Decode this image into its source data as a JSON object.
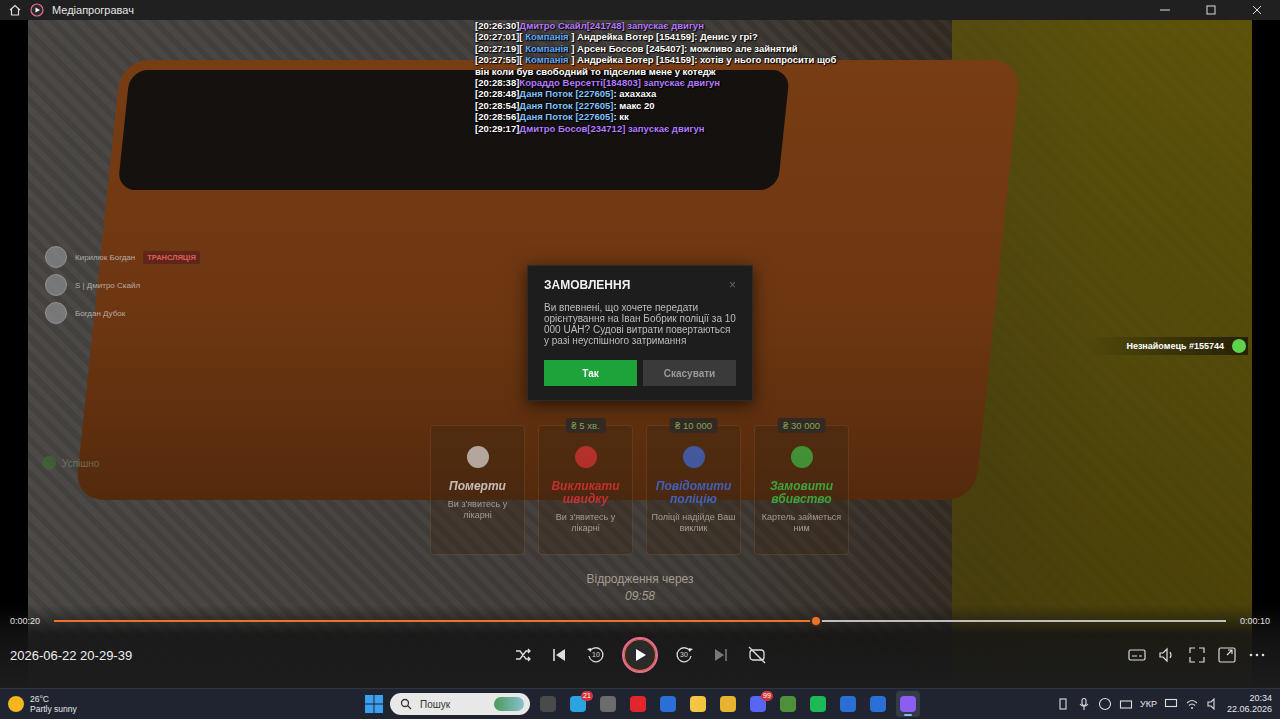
{
  "window": {
    "title": "Медіапрогравач"
  },
  "chat": [
    {
      "time": "[20:26:30]",
      "segments": [
        {
          "text": "Дмитро Скайл[241748] запускає двигун",
          "color": "#b57bff"
        }
      ]
    },
    {
      "time": "[20:27:01]",
      "segments": [
        {
          "text": "[ ",
          "color": "#ffffff"
        },
        {
          "text": "Компанія",
          "color": "#5fa8ff"
        },
        {
          "text": " ] Андрейка Вотер [154159]: Денис у грі?",
          "color": "#ffffff"
        }
      ]
    },
    {
      "time": "[20:27:19]",
      "segments": [
        {
          "text": "[ ",
          "color": "#ffffff"
        },
        {
          "text": "Компанія",
          "color": "#5fa8ff"
        },
        {
          "text": " ] Арсен Боссов [245407]: можливо але зайнятий",
          "color": "#ffffff"
        }
      ]
    },
    {
      "time": "[20:27:55]",
      "segments": [
        {
          "text": "[ ",
          "color": "#ffffff"
        },
        {
          "text": "Компанія",
          "color": "#5fa8ff"
        },
        {
          "text": " ] Андрейка Вотер [154159]: хотів у нього попросити щоб він коли був свободний то підселив мене у котедж",
          "color": "#ffffff"
        }
      ]
    },
    {
      "time": "[20:28:38]",
      "segments": [
        {
          "text": "Кораддо Версетті[184803] запускає двигун",
          "color": "#b57bff"
        }
      ]
    },
    {
      "time": "[20:28:48]",
      "segments": [
        {
          "text": "Даня Поток [227605]",
          "color": "#7fc4ff"
        },
        {
          "text": ": ахахаха",
          "color": "#ffffff"
        }
      ]
    },
    {
      "time": "[20:28:54]",
      "segments": [
        {
          "text": "Даня Поток [227605]",
          "color": "#7fc4ff"
        },
        {
          "text": ": макс 20",
          "color": "#ffffff"
        }
      ]
    },
    {
      "time": "[20:28:56]",
      "segments": [
        {
          "text": "Даня Поток [227605]",
          "color": "#7fc4ff"
        },
        {
          "text": ": кк",
          "color": "#ffffff"
        }
      ]
    },
    {
      "time": "[20:29:17]",
      "segments": [
        {
          "text": "Дмитро Босов[234712] запускає двигун",
          "color": "#b57bff"
        }
      ]
    }
  ],
  "players": [
    {
      "name": "Кирилюк Богдан",
      "badge": "ТРАНСЛЯЦІЯ"
    },
    {
      "name": "S | Дмитро Скайл"
    },
    {
      "name": "Богдан Дубок"
    }
  ],
  "status": "Успішно",
  "dialog": {
    "title": "ЗАМОВЛЕННЯ",
    "close": "×",
    "message": "Ви впевнені, що хочете передати орієнтування на Іван Бобрик поліції за 10 000 UAH? Судові витрати повертаються у разі неуспішного затримання",
    "confirm": "Так",
    "cancel": "Скасувати"
  },
  "cards": [
    {
      "title": "Померти",
      "subtitle": "Ви з'явитесь у лікарні",
      "color": "#e0e0e0"
    },
    {
      "title": "Викликати швидку",
      "subtitle": "Ви з'явитесь у лікарні",
      "price": "₴ 5 хв.",
      "color": "#e0323a"
    },
    {
      "title": "Повідомити поліцію",
      "subtitle": "Поліції надійде Ваш виклик",
      "price": "₴ 10 000",
      "color": "#3d6fe0"
    },
    {
      "title": "Замовити вбивство",
      "subtitle": "Картель займеться ним",
      "price": "₴ 30 000",
      "color": "#39c24a"
    }
  ],
  "target": {
    "label": "Незнайомець #155744"
  },
  "respawn": {
    "label": "Відродження через",
    "time": "09:58"
  },
  "player": {
    "position": "0:00:20",
    "remaining": "0:00:10",
    "level": 0.65,
    "file_time": "2026-06-22 20-29-39",
    "playing": false,
    "skip_back": "10",
    "skip_forward": "30"
  },
  "taskbar": {
    "weather": {
      "temp": "26°C",
      "text": "Partly sunny"
    },
    "search": "Пошук",
    "apps": [
      {
        "color": "#4a4a4a",
        "selected": false
      },
      {
        "color": "#2aa3e0",
        "badge": "21",
        "selected": false
      },
      {
        "color": "#6b6b6b",
        "selected": false
      },
      {
        "color": "#e0262b",
        "selected": false
      },
      {
        "color": "#2a6fd6",
        "selected": false
      },
      {
        "color": "#f4c542",
        "selected": false
      },
      {
        "color": "#e8b32e",
        "selected": false
      },
      {
        "color": "#5865f2",
        "badge": "99",
        "selected": false
      },
      {
        "color": "#4e8f3a",
        "selected": false
      },
      {
        "color": "#1db954",
        "selected": false
      },
      {
        "color": "#2a6fd6",
        "selected": false
      },
      {
        "color": "#2a6fd6",
        "selected": false
      },
      {
        "color": "#8a5cf0",
        "selected": true
      }
    ],
    "language": "УКР",
    "time": "20:34",
    "date": "22.06.2026"
  }
}
